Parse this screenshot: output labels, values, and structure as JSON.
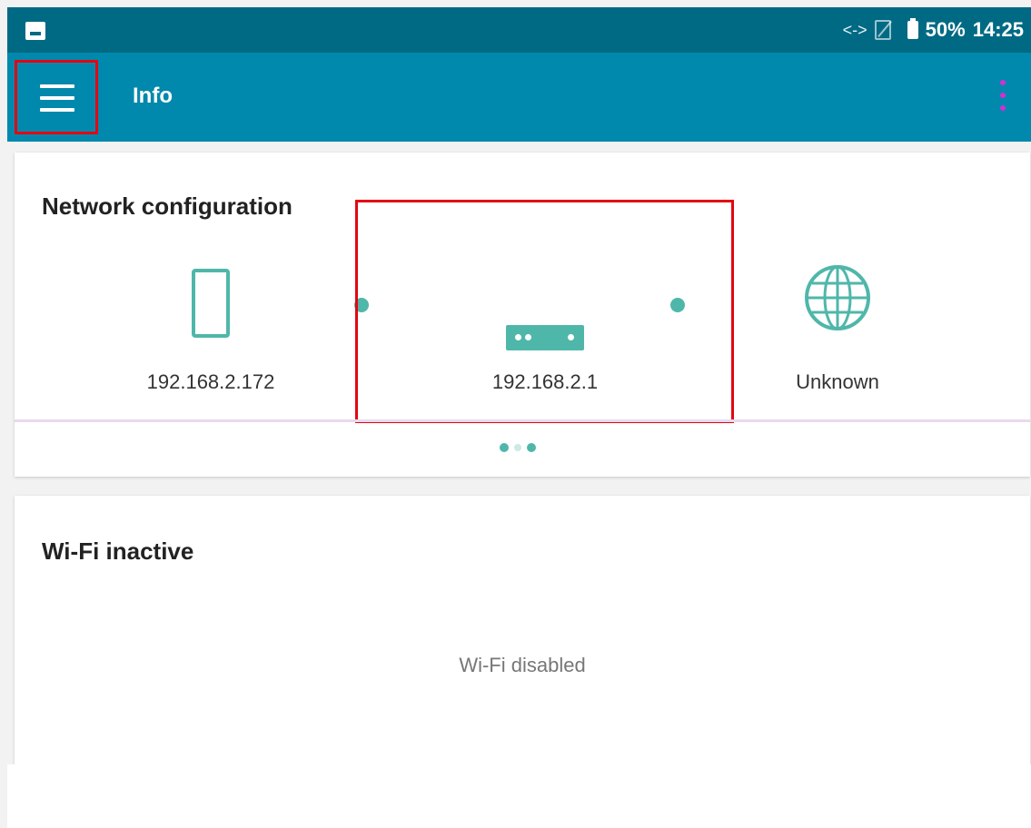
{
  "status_bar": {
    "network_arrows": "<->",
    "battery": "50%",
    "time": "14:25"
  },
  "app_bar": {
    "title": "Info"
  },
  "network_card": {
    "title": "Network configuration",
    "device": {
      "ip": "192.168.2.172",
      "icon": "smartphone-icon"
    },
    "router": {
      "ip": "192.168.2.1",
      "icon": "router-icon"
    },
    "internet": {
      "ip": "Unknown",
      "icon": "globe-icon"
    },
    "pager": {
      "page_count": 3,
      "active_page": 2
    }
  },
  "wifi_card": {
    "title": "Wi-Fi inactive",
    "status": "Wi-Fi disabled"
  },
  "colors": {
    "status_bar": "#006a84",
    "app_bar": "#0088ad",
    "accent": "#4fb7aa",
    "highlight": "#e30613"
  }
}
